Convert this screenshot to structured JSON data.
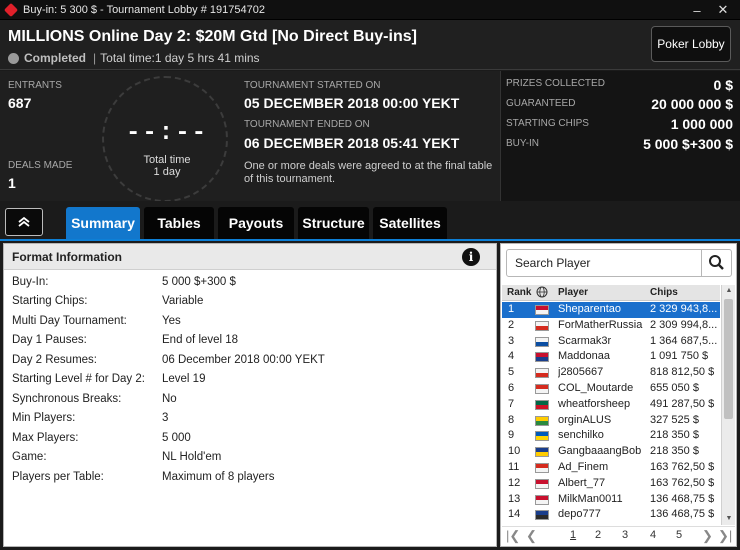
{
  "window": {
    "title": "Buy-in: 5 300 $ - Tournament Lobby # 191754702"
  },
  "header": {
    "title": "MILLIONS Online Day 2: $20M Gtd [No Direct Buy-ins]",
    "status": "Completed",
    "total_time": "Total time:1 day 5 hrs  41 mins",
    "lobby_button": "Poker Lobby"
  },
  "stats": {
    "entrants_label": "ENTRANTS",
    "entrants_value": "687",
    "deals_label": "DEALS MADE",
    "deals_value": "1",
    "clock_digits": "--:--",
    "clock_label": "Total time",
    "clock_value": "1 day",
    "started_label": "TOURNAMENT STARTED ON",
    "started_value": "05 DECEMBER 2018  00:00 YEKT",
    "ended_label": "TOURNAMENT ENDED ON",
    "ended_value": "06 DECEMBER 2018  05:41 YEKT",
    "note": "One or more deals were agreed to at the final table of this tournament."
  },
  "prizes": [
    {
      "label": "PRIZES COLLECTED",
      "value": "0 $"
    },
    {
      "label": "GUARANTEED",
      "value": "20 000 000 $"
    },
    {
      "label": "STARTING CHIPS",
      "value": "1 000 000"
    },
    {
      "label": "BUY-IN",
      "value": "5 000 $+300 $"
    }
  ],
  "tabs": [
    "Summary",
    "Tables",
    "Payouts",
    "Structure",
    "Satellites"
  ],
  "format": {
    "title": "Format Information",
    "rows": [
      {
        "label": "Buy-In:",
        "value": "5 000 $+300 $"
      },
      {
        "label": "Starting Chips:",
        "value": "Variable"
      },
      {
        "label": "Multi Day Tournament:",
        "value": "Yes"
      },
      {
        "label": "Day 1 Pauses:",
        "value": "End of level 18"
      },
      {
        "label": "Day 2 Resumes:",
        "value": "06 December 2018  00:00 YEKT"
      },
      {
        "label": "Starting Level # for Day 2:",
        "value": "Level 19"
      },
      {
        "label": "Synchronous Breaks:",
        "value": "No"
      },
      {
        "label": "Min Players:",
        "value": "3"
      },
      {
        "label": "Max Players:",
        "value": "5 000"
      },
      {
        "label": "Game:",
        "value": "NL Hold'em"
      },
      {
        "label": "Players per Table:",
        "value": "Maximum of 8 players"
      }
    ]
  },
  "players": {
    "search_placeholder": "Search Player",
    "columns": {
      "rank": "Rank",
      "player": "Player",
      "chips": "Chips"
    },
    "rows": [
      {
        "rank": "1",
        "name": "Sheparentao",
        "chips": "2 329 943,8...",
        "flag_top": "#c8102e",
        "flag_bottom": "#f4f4f4"
      },
      {
        "rank": "2",
        "name": "ForMatherRussia",
        "chips": "2 309 994,8...",
        "flag_top": "#f4f4f4",
        "flag_bottom": "#d52b1e"
      },
      {
        "rank": "3",
        "name": "Scarmak3r",
        "chips": "1 364 687,5...",
        "flag_top": "#f4f4f4",
        "flag_bottom": "#0b4ea2"
      },
      {
        "rank": "4",
        "name": "Maddonaa",
        "chips": "1 091 750 $",
        "flag_top": "#c8102e",
        "flag_bottom": "#1a3e8c"
      },
      {
        "rank": "5",
        "name": "j2805667",
        "chips": "818 812,50 $",
        "flag_top": "#f4f4f4",
        "flag_bottom": "#d52b1e"
      },
      {
        "rank": "6",
        "name": "COL_Moutarde",
        "chips": "655 050 $",
        "flag_top": "#d52b1e",
        "flag_bottom": "#f4f4f4"
      },
      {
        "rank": "7",
        "name": "wheatforsheep",
        "chips": "491 287,50 $",
        "flag_top": "#006847",
        "flag_bottom": "#ce1126"
      },
      {
        "rank": "8",
        "name": "orginALUS",
        "chips": "327 525 $",
        "flag_top": "#ffcc00",
        "flag_bottom": "#2b8a3e"
      },
      {
        "rank": "9",
        "name": "senchilko",
        "chips": "218 350 $",
        "flag_top": "#005bbb",
        "flag_bottom": "#ffd500"
      },
      {
        "rank": "10",
        "name": "GangbaaangBob",
        "chips": "218 350 $",
        "flag_top": "#1a3e8c",
        "flag_bottom": "#ffcc00"
      },
      {
        "rank": "11",
        "name": "Ad_Finem",
        "chips": "163 762,50 $",
        "flag_top": "#d52b1e",
        "flag_bottom": "#f4f4f4"
      },
      {
        "rank": "12",
        "name": "Albert_77",
        "chips": "163 762,50 $",
        "flag_top": "#c8102e",
        "flag_bottom": "#f4f4f4"
      },
      {
        "rank": "13",
        "name": "MilkMan0011",
        "chips": "136 468,75 $",
        "flag_top": "#c8102e",
        "flag_bottom": "#f4f4f4"
      },
      {
        "rank": "14",
        "name": "depo777",
        "chips": "136 468,75 $",
        "flag_top": "#1a3e8c",
        "flag_bottom": "#2b2b2b"
      }
    ],
    "pages": [
      "1",
      "2",
      "3",
      "4",
      "5"
    ],
    "current_page": "1"
  },
  "colors": {
    "accent": "#1277cc",
    "selected_row": "#1a6fcc",
    "brand_red": "#e0202a"
  }
}
